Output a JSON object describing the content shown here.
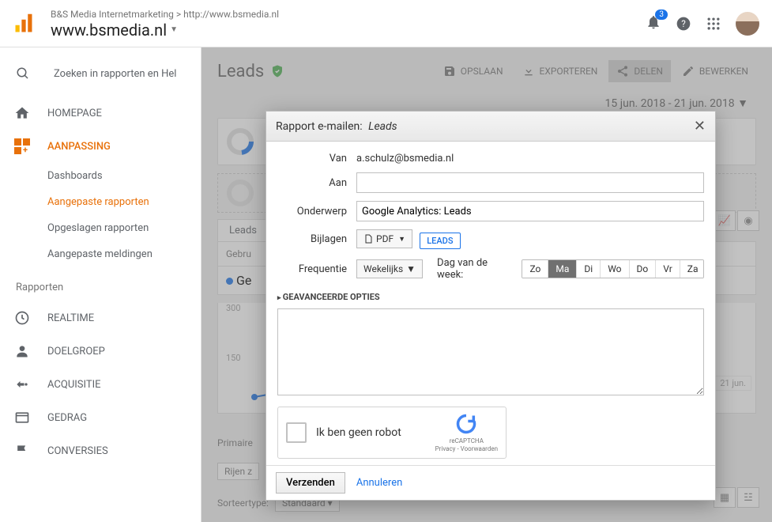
{
  "breadcrumb": {
    "account": "B&S Media Internetmarketing",
    "sep": ">",
    "url": "http://www.bsmedia.nl"
  },
  "domainTitle": "www.bsmedia.nl",
  "notifications": "3",
  "search": {
    "placeholder": "Zoeken in rapporten en Hel"
  },
  "nav": {
    "homepage": "HOMEPAGE",
    "aanpassing": "AANPASSING",
    "sub": {
      "dashboards": "Dashboards",
      "aangepaste_rapporten": "Aangepaste rapporten",
      "opgeslagen_rapporten": "Opgeslagen rapporten",
      "aangepaste_meldingen": "Aangepaste meldingen"
    },
    "rapporten_label": "Rapporten",
    "realtime": "REALTIME",
    "doelgroep": "DOELGROEP",
    "acquisitie": "ACQUISITIE",
    "gedrag": "GEDRAG",
    "conversies": "CONVERSIES"
  },
  "page": {
    "title": "Leads",
    "toolbar": {
      "opslaan": "OPSLAAN",
      "exporteren": "EXPORTEREN",
      "delen": "DELEN",
      "bewerken": "BEWERKEN"
    },
    "dateRange": "15 jun. 2018 - 21 jun. 2018",
    "tab": "Leads",
    "gebru": "Gebru",
    "legend": "Ge",
    "y1": "300",
    "y2": "150",
    "xRight": "21 jun.",
    "primaire": "Primaire",
    "rijen": "Rijen z",
    "sort_label": "Sorteertype:",
    "sort_value": "Standaard"
  },
  "modal": {
    "title_prefix": "Rapport e-mailen:",
    "title_report": "Leads",
    "labels": {
      "van": "Van",
      "aan": "Aan",
      "onderwerp": "Onderwerp",
      "bijlagen": "Bijlagen",
      "frequentie": "Frequentie"
    },
    "van_value": "a.schulz@bsmedia.nl",
    "onderwerp_value": "Google Analytics: Leads",
    "pdf": "PDF",
    "tag": "LEADS",
    "freq_value": "Wekelijks",
    "dow_label": "Dag van de week:",
    "dow": [
      "Zo",
      "Ma",
      "Di",
      "Wo",
      "Do",
      "Vr",
      "Za"
    ],
    "advanced": "GEAVANCEERDE OPTIES",
    "captcha": {
      "text": "Ik ben geen robot",
      "brand": "reCAPTCHA",
      "privacy": "Privacy - Voorwaarden"
    },
    "send": "Verzenden",
    "cancel": "Annuleren"
  }
}
